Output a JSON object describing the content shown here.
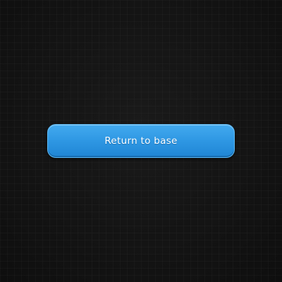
{
  "main": {
    "return_button": {
      "label": "Return to base"
    }
  },
  "colors": {
    "background": "#141414",
    "button_top": "#43aaef",
    "button_bottom": "#1f85d4",
    "button_text": "#ffffff"
  }
}
